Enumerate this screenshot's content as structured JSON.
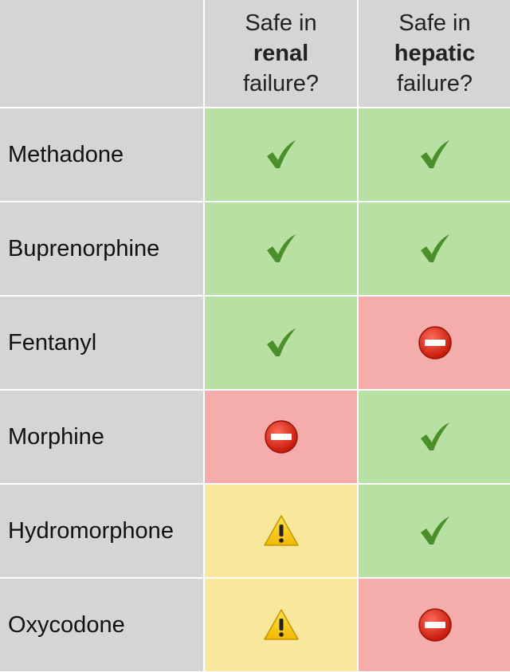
{
  "header": {
    "col1": {
      "line1": "Safe in",
      "line2": "renal",
      "line3": "failure?"
    },
    "col2": {
      "line1": "Safe in",
      "line2": "hepatic",
      "line3": "failure?"
    }
  },
  "legend_colors": {
    "safe": "#b8e0a2",
    "unsafe": "#f4adab",
    "caution": "#f9e89b"
  },
  "rows": [
    {
      "drug": "Methadone",
      "renal": "safe",
      "hepatic": "safe"
    },
    {
      "drug": "Buprenorphine",
      "renal": "safe",
      "hepatic": "safe"
    },
    {
      "drug": "Fentanyl",
      "renal": "safe",
      "hepatic": "unsafe"
    },
    {
      "drug": "Morphine",
      "renal": "unsafe",
      "hepatic": "safe"
    },
    {
      "drug": "Hydromorphone",
      "renal": "caution",
      "hepatic": "safe"
    },
    {
      "drug": "Oxycodone",
      "renal": "caution",
      "hepatic": "unsafe"
    }
  ],
  "icons": {
    "safe": "checkmark-icon",
    "unsafe": "no-entry-icon",
    "caution": "warning-icon"
  }
}
